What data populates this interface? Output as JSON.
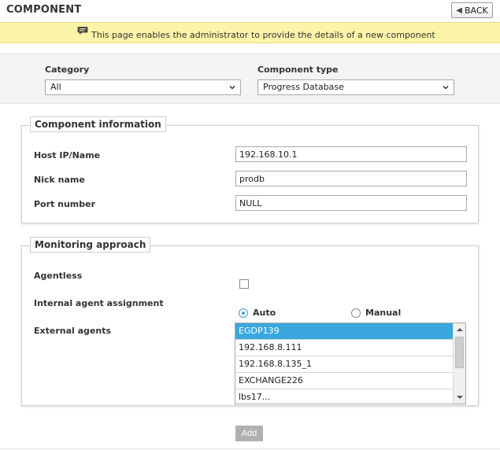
{
  "header": {
    "title": "COMPONENT",
    "back_label": "BACK"
  },
  "info_bar": {
    "message": "This page enables the administrator to provide the details of a new component"
  },
  "filters": {
    "category_label": "Category",
    "category_value": "All",
    "component_type_label": "Component type",
    "component_type_value": "Progress Database"
  },
  "component_info": {
    "legend": "Component information",
    "host_label": "Host IP/Name",
    "host_value": "192.168.10.1",
    "nick_label": "Nick name",
    "nick_value": "prodb",
    "port_label": "Port number",
    "port_value": "NULL"
  },
  "monitoring": {
    "legend": "Monitoring approach",
    "agentless_label": "Agentless",
    "agentless_checked": false,
    "internal_label": "Internal agent assignment",
    "auto_label": "Auto",
    "manual_label": "Manual",
    "selected_assignment": "Auto",
    "external_label": "External agents",
    "agents": [
      "EGDP139",
      "192.168.8.111",
      "192.168.8.135_1",
      "EXCHANGE226",
      "lbs17..."
    ],
    "selected_agent": "EGDP139"
  },
  "actions": {
    "add_label": "Add"
  },
  "colors": {
    "info_bar_bg": "#fcf5a9",
    "selected_item": "#3aa8df",
    "radio_accent": "#3b9bd9",
    "add_button": "#b0b0b0"
  }
}
